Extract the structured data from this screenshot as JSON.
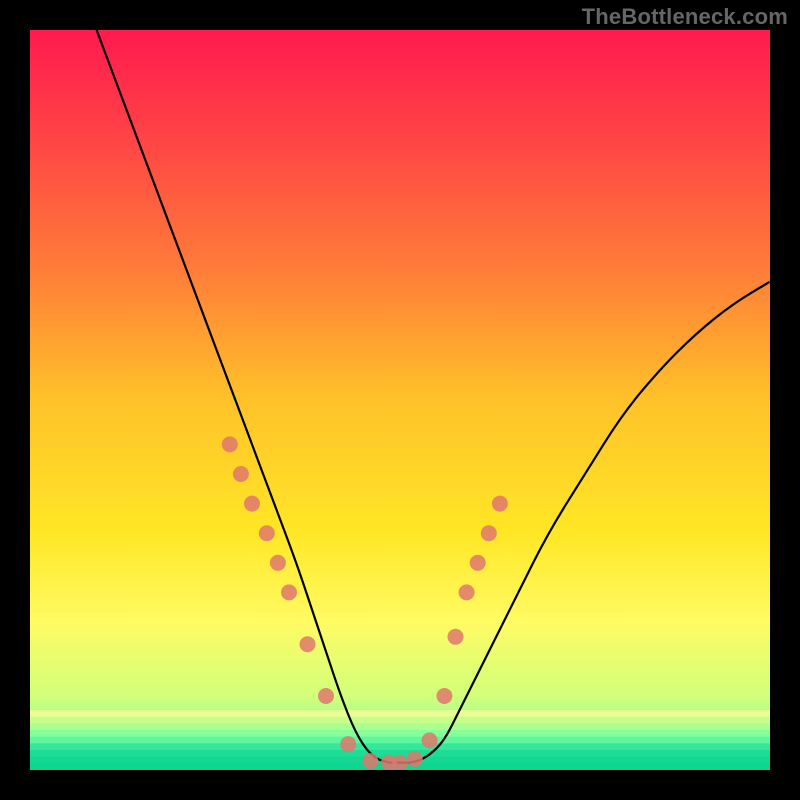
{
  "attribution": "TheBottleneck.com",
  "chart_data": {
    "type": "line",
    "title": "",
    "xlabel": "",
    "ylabel": "",
    "xlim": [
      0,
      100
    ],
    "ylim": [
      0,
      100
    ],
    "grid": false,
    "legend": false,
    "background_gradient": {
      "stops": [
        {
          "offset": 0.0,
          "color": "#ff1a4f"
        },
        {
          "offset": 0.15,
          "color": "#ff4545"
        },
        {
          "offset": 0.32,
          "color": "#ff7b39"
        },
        {
          "offset": 0.5,
          "color": "#ffc229"
        },
        {
          "offset": 0.68,
          "color": "#ffe726"
        },
        {
          "offset": 0.8,
          "color": "#fffb63"
        },
        {
          "offset": 0.9,
          "color": "#d2ff7a"
        },
        {
          "offset": 0.96,
          "color": "#7dffa0"
        },
        {
          "offset": 1.0,
          "color": "#0cd98b"
        }
      ],
      "bottom_bands": [
        "#e9ff93",
        "#c8ff8a",
        "#a9ff8f",
        "#86ff9a",
        "#5cf7a0",
        "#36e79b",
        "#1ddc95",
        "#13d892",
        "#0cd68f"
      ]
    },
    "series": [
      {
        "name": "bottleneck-curve",
        "x": [
          9,
          12,
          15,
          18,
          21,
          24,
          27,
          30,
          33,
          36,
          38,
          40,
          42,
          44,
          46,
          48,
          50,
          52,
          54,
          56,
          58,
          62,
          66,
          70,
          75,
          80,
          85,
          90,
          95,
          100
        ],
        "y": [
          100,
          92,
          84,
          76,
          68,
          60,
          52,
          44,
          36,
          28,
          22,
          16,
          10,
          5,
          2,
          1,
          1,
          1,
          2,
          4,
          8,
          16,
          24,
          32,
          40,
          48,
          54,
          59,
          63,
          66
        ]
      }
    ],
    "scatter_points": {
      "name": "highlight-dots",
      "color": "#e0776d",
      "x": [
        27.0,
        28.5,
        30.0,
        32.0,
        33.5,
        35.0,
        37.5,
        40.0,
        43.0,
        46.0,
        48.5,
        50.0,
        52.0,
        54.0,
        56.0,
        57.5,
        59.0,
        60.5,
        62.0,
        63.5
      ],
      "y": [
        44.0,
        40.0,
        36.0,
        32.0,
        28.0,
        24.0,
        17.0,
        10.0,
        3.5,
        1.2,
        1.0,
        1.0,
        1.5,
        4.0,
        10.0,
        18.0,
        24.0,
        28.0,
        32.0,
        36.0
      ]
    }
  }
}
